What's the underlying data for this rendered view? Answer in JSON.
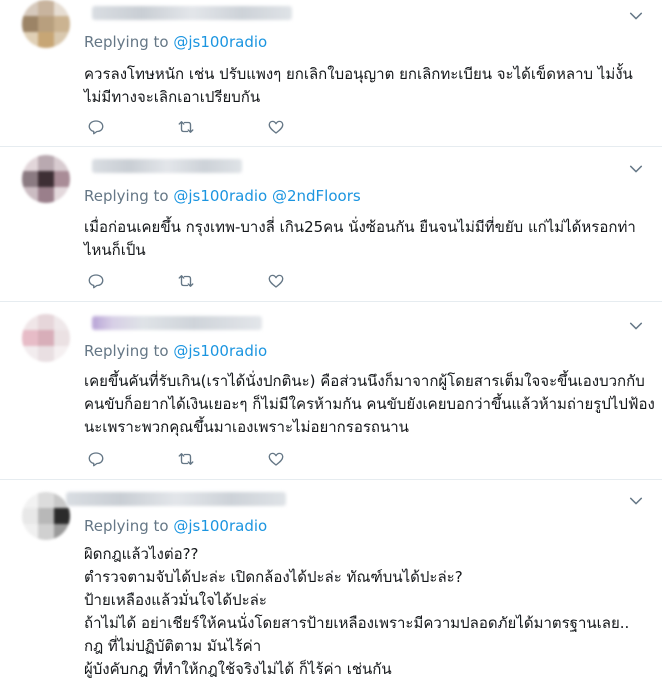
{
  "common": {
    "replying_prefix": "Replying to"
  },
  "tweets": [
    {
      "handles": [
        "@js100radio"
      ],
      "lines": [
        "ควรลงโทษหนัก เช่น ปรับแพงๆ ยกเลิกใบอนุญาต ยกเลิกทะเบียน จะได้เข็ดหลาบ ไม่งั้น",
        "ไม่มีทางจะเลิกเอาเปรียบกัน"
      ]
    },
    {
      "handles": [
        "@js100radio",
        "@2ndFloors"
      ],
      "lines": [
        "เมื่อก่อนเคยขึ้น กรุงเทพ-บางลี่ เกิน25คน นั่งซ้อนกัน ยืนจนไม่มีที่ขยับ แก่ไม่ได้หรอกท่า",
        "ไหนก็เป็น"
      ]
    },
    {
      "handles": [
        "@js100radio"
      ],
      "lines": [
        "เคยขึ้นคันที่รับเกิน(เราได้นั่งปกตินะ) คือส่วนนึงก็มาจากผู้โดยสารเต็มใจจะขึ้นเองบวกกับ",
        "คนขับก็อยากได้เงินเยอะๆ ก็ไม่มีใครห้ามกัน คนขับยังเคยบอกว่าขึ้นแล้วห้ามถ่ายรูปไปฟ้อง",
        "นะเพราะพวกคุณขึ้นมาเองเพราะไม่อยากรอรถนาน"
      ]
    },
    {
      "handles": [
        "@js100radio"
      ],
      "lines": [
        "ผิดกฎแล้วไงต่อ??",
        "ตำรวจตามจับได้ปะล่ะ เปิดกล้องได้ปะล่ะ ทัณฑ์บนได้ปะล่ะ?",
        "ป้ายเหลืองแล้วมั่นใจได้ปะล่ะ",
        "ถ้าไม่ได้ อย่าเชียร์ให้คนนั่งโดยสารป้ายเหลืองเพราะมีความปลอดภัยได้มาตรฐานเลย..",
        "กฎ ที่ไม่ปฏิบัติตาม มันไร้ค่า",
        "ผู้บังคับกฎ ที่ทำให้กฎใช้จริงไม่ได้ ก็ไร้ค่า เช่นกัน"
      ]
    }
  ],
  "colors": {
    "link": "#1b95e0",
    "secondary": "#657786",
    "divider": "#e6ecf0"
  },
  "icons": [
    "chevron-down-icon",
    "reply-icon",
    "retweet-icon",
    "like-icon"
  ]
}
